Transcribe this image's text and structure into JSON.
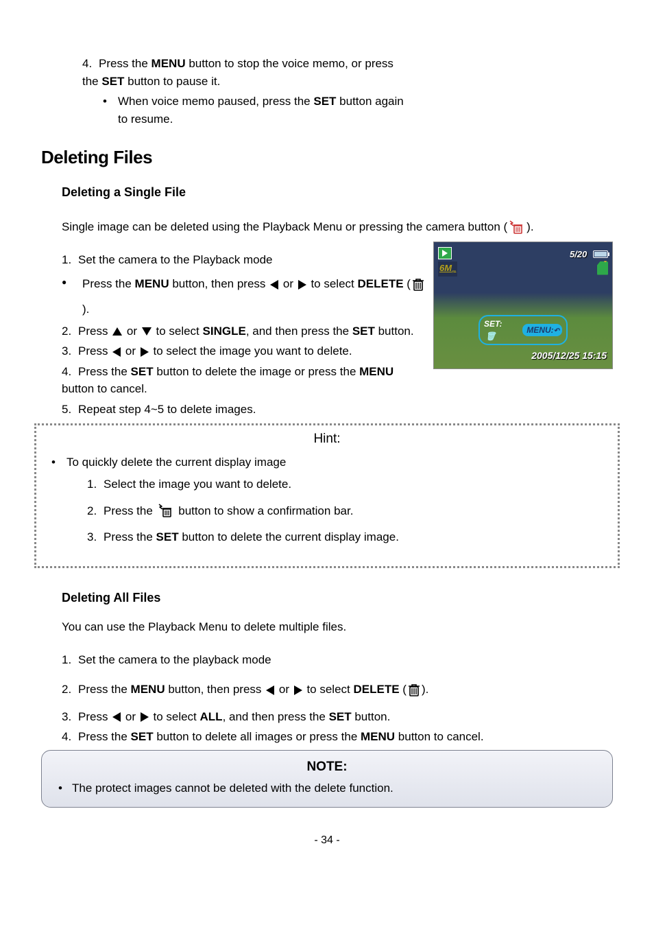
{
  "section_memo": {
    "step4_a": "Press the ",
    "menu": "MENU",
    "step4_b": " button to stop the voice memo, or press the ",
    "set": "SET",
    "step4_c": " button to pause it.",
    "sub_a": "When voice memo paused, press the ",
    "sub_b": " button again to resume."
  },
  "heading_delete": "Deleting Files",
  "sub_single": "Deleting a Single File",
  "single_intro_a": "Single image can be deleted using the Playback Menu or pressing the camera button (",
  "single_intro_b": ").",
  "single_steps": {
    "s1": "Set the camera to the Playback mode",
    "bullet_a": "Press the ",
    "bullet_b": " button, then press ",
    "bullet_c": " or ",
    "bullet_d": " to select ",
    "delete_label": "DELETE",
    "bullet_e": " (",
    "bullet_f": ").",
    "s2a": "Press ",
    "s2b": " or ",
    "s2c": " to select ",
    "single_label": "SINGLE",
    "s2d": ", and then press the ",
    "s2e": " button.",
    "s3a": "Press ",
    "s3b": " or ",
    "s3c": " to select the image you want to delete.",
    "s4a": "Press the ",
    "s4b": " button to delete the image or press the ",
    "s4c": " button to cancel.",
    "s5": "Repeat step 4~5 to delete images."
  },
  "lcd": {
    "count": "5/20",
    "res": "6M",
    "set": "SET:",
    "menu": "MENU:",
    "date": "2005/12/25 15:15"
  },
  "hint": {
    "title": "Hint:",
    "main": "To quickly delete the current display image",
    "s1": "Select the image you want to delete.",
    "s2a": "Press the ",
    "s2b": " button to show a confirmation bar.",
    "s3a": "Press the ",
    "s3b": " button to delete the current display image."
  },
  "sub_all": "Deleting All Files",
  "all_intro": "You can use the Playback Menu to delete multiple files.",
  "all_steps": {
    "s1": "Set the camera to the playback mode",
    "s2a": "Press the ",
    "s2b": " button, then press ",
    "s2c": " or ",
    "s2d": " to select ",
    "s2e": " (",
    "s2f": ").",
    "s3a": "Press ",
    "s3b": " or ",
    "s3c": " to select ",
    "all_label": "ALL",
    "s3d": ", and then press the ",
    "s3e": " button.",
    "s4a": "Press the ",
    "s4b": " button to delete all images or press the ",
    "s4c": " button to cancel."
  },
  "note": {
    "title": "NOTE:",
    "body": "The protect images cannot be deleted with the delete function."
  },
  "page": "- 34 -",
  "labels": {
    "menu": "MENU",
    "set": "SET",
    "delete": "DELETE"
  }
}
